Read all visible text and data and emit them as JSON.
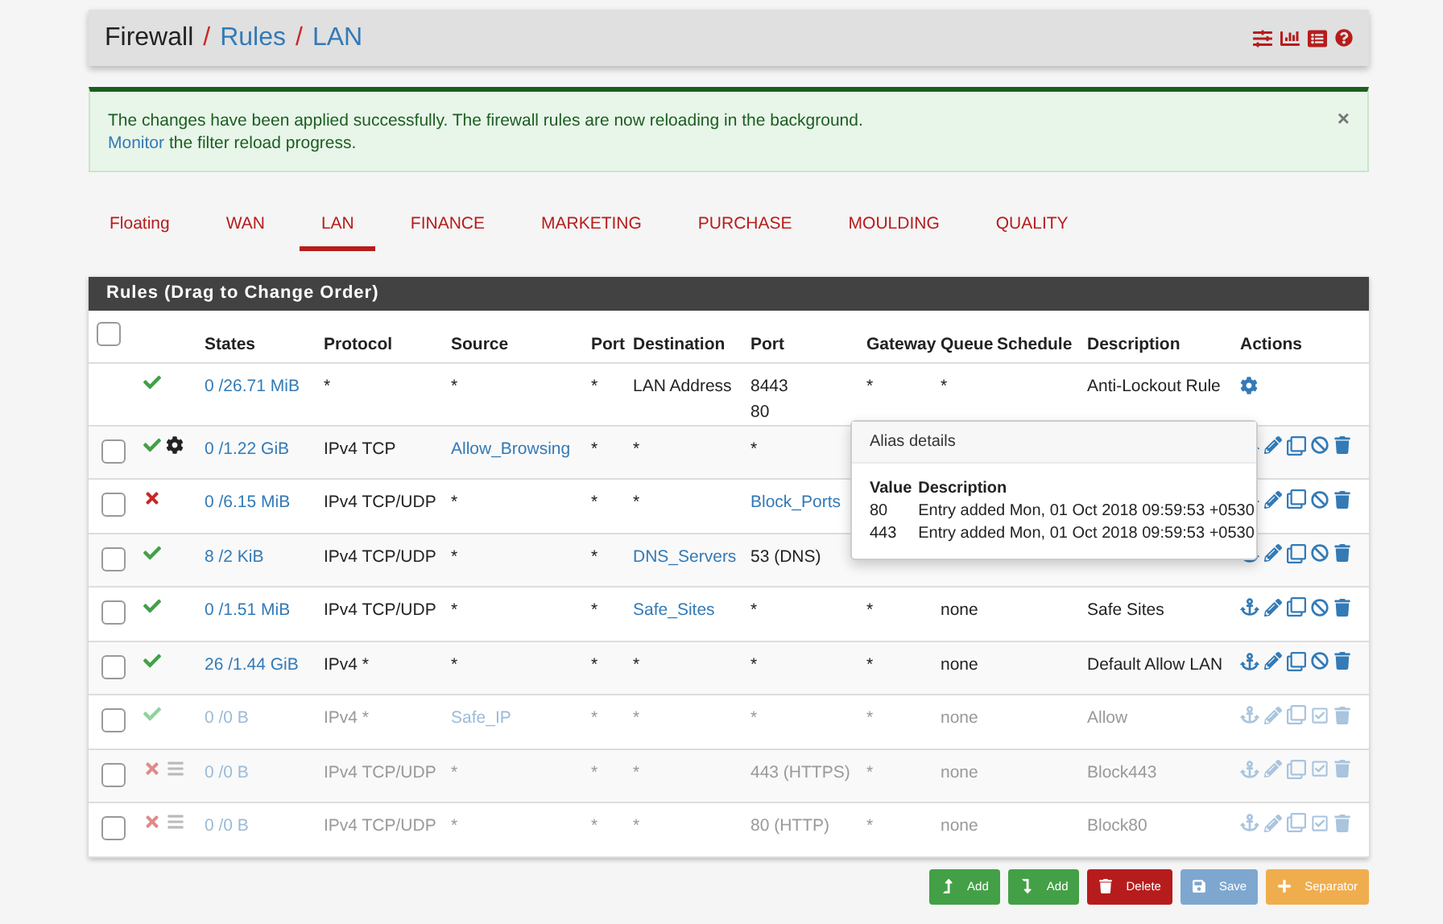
{
  "breadcrumb": [
    {
      "text": "Firewall",
      "link": false
    },
    {
      "text": "Rules",
      "link": true
    },
    {
      "text": "LAN",
      "link": true
    }
  ],
  "breadcrumb_separator": "/",
  "select_all": {
    "checked": false
  },
  "alert": {
    "message": "The changes have been applied successfully. The firewall rules are now reloading in the background.",
    "link": "Monitor",
    "link_rest": "the filter reload progress.",
    "close": "×"
  },
  "tabs": [
    {
      "label": "Floating",
      "selected": false
    },
    {
      "label": "WAN",
      "selected": false
    },
    {
      "label": "LAN",
      "selected": true
    },
    {
      "label": "FINANCE",
      "selected": false
    },
    {
      "label": "MARKETING",
      "selected": false
    },
    {
      "label": "PURCHASE",
      "selected": false
    },
    {
      "label": "MOULDING",
      "selected": false
    },
    {
      "label": "QUALITY",
      "selected": false
    }
  ],
  "panel_title": "Rules (Drag to Change Order)",
  "columns": [
    "States",
    "Protocol",
    "Source",
    "Port",
    "Destination",
    "Port",
    "Gateway",
    "Queue",
    "Schedule",
    "Description",
    "Actions"
  ],
  "rows": [
    {
      "kind": "anti_lockout",
      "blocked": false,
      "advanced": false,
      "logged": false,
      "disabled": false,
      "cells": [
        {
          "text": "0 /26.71 MiB",
          "link": true
        },
        {
          "text": "*",
          "link": false
        },
        {
          "text": "*",
          "link": false
        },
        {
          "text": "*",
          "link": false
        },
        {
          "text": "LAN Address",
          "link": false
        },
        {
          "text": [
            "8443",
            "80"
          ],
          "link": false
        },
        {
          "text": "*",
          "link": false
        },
        {
          "text": "*",
          "link": false
        },
        null,
        {
          "text": "Anti-Lockout Rule",
          "link": false
        }
      ]
    },
    {
      "kind": "rule",
      "checked": false,
      "blocked": false,
      "advanced": true,
      "logged": false,
      "disabled": false,
      "cells": [
        {
          "text": "0 /1.22 GiB",
          "link": true
        },
        {
          "text": "IPv4 TCP",
          "link": false
        },
        {
          "text": "Allow_Browsing",
          "link": true
        },
        {
          "text": "*",
          "link": false
        },
        {
          "text": "*",
          "link": false
        },
        {
          "text": "*",
          "link": false
        },
        null,
        null,
        null,
        null
      ]
    },
    {
      "kind": "rule",
      "checked": false,
      "blocked": true,
      "advanced": false,
      "logged": false,
      "disabled": false,
      "cells": [
        {
          "text": "0 /6.15 MiB",
          "link": true
        },
        {
          "text": "IPv4 TCP/UDP",
          "link": false
        },
        {
          "text": "*",
          "link": false
        },
        {
          "text": "*",
          "link": false
        },
        {
          "text": "*",
          "link": false
        },
        {
          "text": "Block_Ports",
          "link": true
        },
        null,
        null,
        null,
        null
      ]
    },
    {
      "kind": "rule",
      "checked": false,
      "blocked": false,
      "advanced": false,
      "logged": false,
      "disabled": false,
      "cells": [
        {
          "text": "8 /2 KiB",
          "link": true
        },
        {
          "text": "IPv4 TCP/UDP",
          "link": false
        },
        {
          "text": "*",
          "link": false
        },
        {
          "text": "*",
          "link": false
        },
        {
          "text": "DNS_Servers",
          "link": true
        },
        {
          "text": "53 (DNS)",
          "link": false
        },
        null,
        null,
        null,
        null
      ]
    },
    {
      "kind": "rule",
      "checked": false,
      "blocked": false,
      "advanced": false,
      "logged": false,
      "disabled": false,
      "cells": [
        {
          "text": "0 /1.51 MiB",
          "link": true
        },
        {
          "text": "IPv4 TCP/UDP",
          "link": false
        },
        {
          "text": "*",
          "link": false
        },
        {
          "text": "*",
          "link": false
        },
        {
          "text": "Safe_Sites",
          "link": true
        },
        {
          "text": "*",
          "link": false
        },
        {
          "text": "*",
          "link": false
        },
        {
          "text": "none",
          "link": false
        },
        null,
        {
          "text": "Safe Sites",
          "link": false
        }
      ]
    },
    {
      "kind": "rule",
      "checked": false,
      "blocked": false,
      "advanced": false,
      "logged": false,
      "disabled": false,
      "cells": [
        {
          "text": "26 /1.44 GiB",
          "link": true
        },
        {
          "text": "IPv4 *",
          "link": false
        },
        {
          "text": "*",
          "link": false
        },
        {
          "text": "*",
          "link": false
        },
        {
          "text": "*",
          "link": false
        },
        {
          "text": "*",
          "link": false
        },
        {
          "text": "*",
          "link": false
        },
        {
          "text": "none",
          "link": false
        },
        null,
        {
          "text": "Default Allow LAN",
          "link": false
        }
      ]
    },
    {
      "kind": "rule",
      "checked": false,
      "blocked": false,
      "advanced": false,
      "logged": false,
      "disabled": true,
      "cells": [
        {
          "text": "0 /0 B",
          "link": true
        },
        {
          "text": "IPv4 *",
          "link": false
        },
        {
          "text": "Safe_IP",
          "link": true
        },
        {
          "text": "*",
          "link": false
        },
        {
          "text": "*",
          "link": false
        },
        {
          "text": "*",
          "link": false
        },
        {
          "text": "*",
          "link": false
        },
        {
          "text": "none",
          "link": false
        },
        null,
        {
          "text": "Allow",
          "link": false
        }
      ]
    },
    {
      "kind": "rule",
      "checked": false,
      "blocked": true,
      "advanced": false,
      "logged": true,
      "disabled": true,
      "cells": [
        {
          "text": "0 /0 B",
          "link": true
        },
        {
          "text": "IPv4 TCP/UDP",
          "link": false
        },
        {
          "text": "*",
          "link": false
        },
        {
          "text": "*",
          "link": false
        },
        {
          "text": "*",
          "link": false
        },
        {
          "text": "443 (HTTPS)",
          "link": false
        },
        {
          "text": "*",
          "link": false
        },
        {
          "text": "none",
          "link": false
        },
        null,
        {
          "text": "Block443",
          "link": false
        }
      ]
    },
    {
      "kind": "rule",
      "checked": false,
      "blocked": true,
      "advanced": false,
      "logged": true,
      "disabled": true,
      "cells": [
        {
          "text": "0 /0 B",
          "link": true
        },
        {
          "text": "IPv4 TCP/UDP",
          "link": false
        },
        {
          "text": "*",
          "link": false
        },
        {
          "text": "*",
          "link": false
        },
        {
          "text": "*",
          "link": false
        },
        {
          "text": "80 (HTTP)",
          "link": false
        },
        {
          "text": "*",
          "link": false
        },
        {
          "text": "none",
          "link": false
        },
        null,
        {
          "text": "Block80",
          "link": false
        }
      ]
    }
  ],
  "popover": {
    "title": "Alias details",
    "columns": [
      "Value",
      "Description"
    ],
    "rows": [
      [
        "80",
        "Entry added Mon, 01 Oct 2018 09:59:53 +0530"
      ],
      [
        "443",
        "Entry added Mon, 01 Oct 2018 09:59:53 +0530"
      ]
    ]
  },
  "buttons": [
    {
      "label": "Add",
      "kind": "add_top"
    },
    {
      "label": "Add",
      "kind": "add_bottom"
    },
    {
      "label": "Delete",
      "kind": "delete"
    },
    {
      "label": "Save",
      "kind": "save"
    },
    {
      "label": "Separator",
      "kind": "separator"
    }
  ]
}
